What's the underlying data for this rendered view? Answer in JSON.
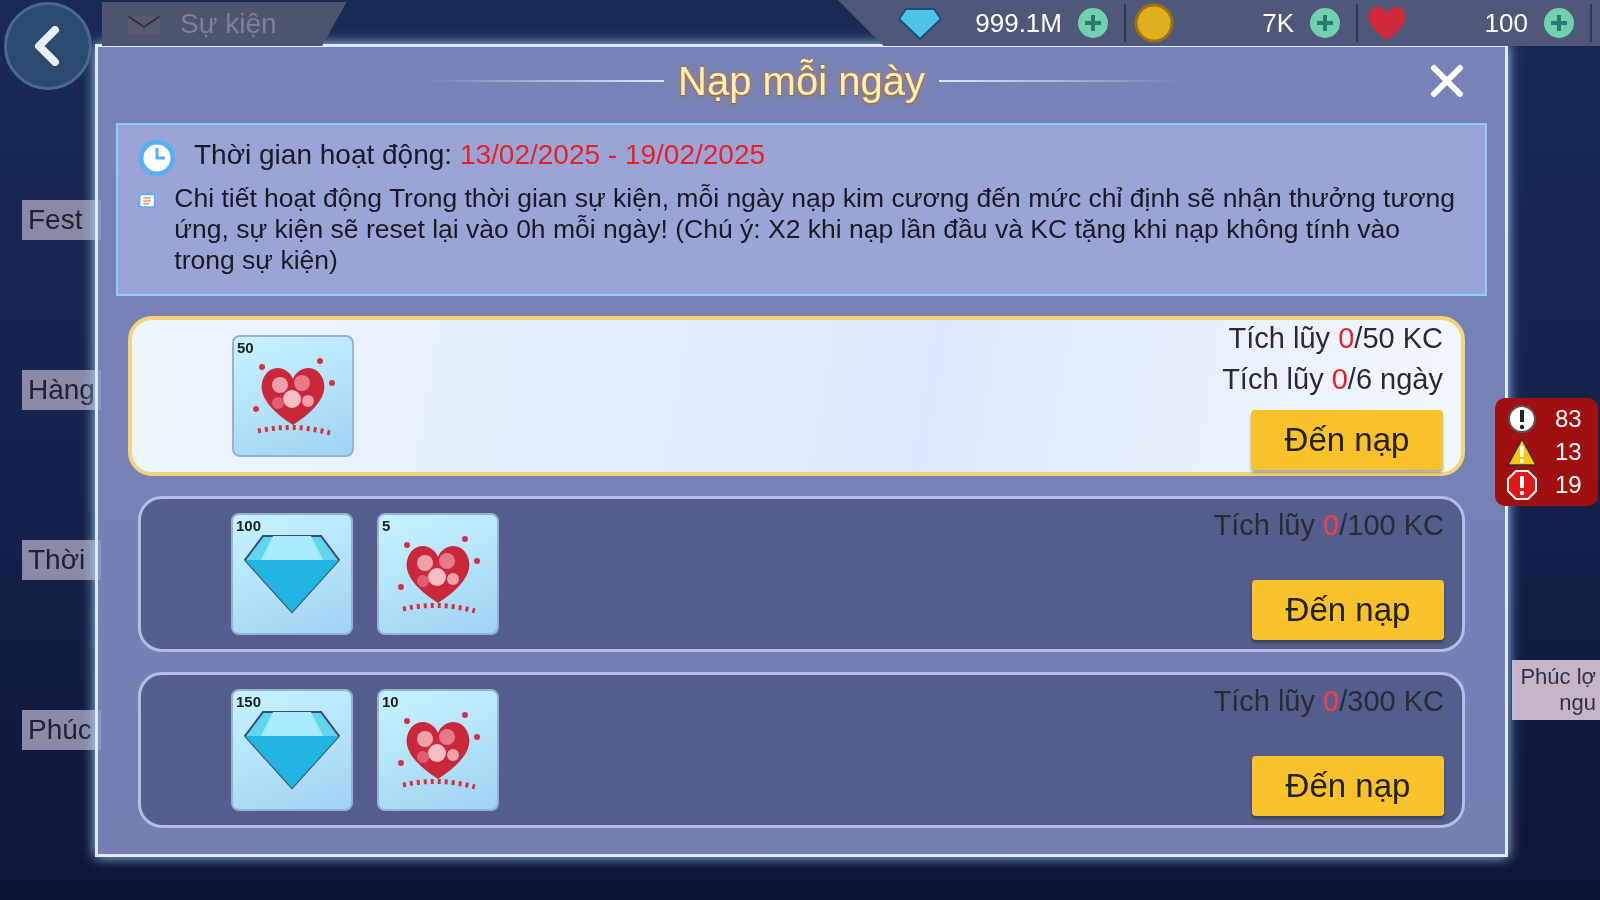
{
  "top_bar": {
    "section_title": "Sự kiện",
    "currencies": [
      {
        "kind": "diamond",
        "amount": "999.1M"
      },
      {
        "kind": "coin",
        "amount": "7K"
      },
      {
        "kind": "heart",
        "amount": "100"
      }
    ]
  },
  "side_tabs": [
    {
      "label": "Fest"
    },
    {
      "label": "Hàng"
    },
    {
      "label": "Thời"
    },
    {
      "label": "Phúc"
    }
  ],
  "right_peek": "Phúc lợ ngu",
  "dialog": {
    "title": "Nạp mỗi ngày",
    "info": {
      "time_label": "Thời gian hoạt động:",
      "time_range": "13/02/2025 - 19/02/2025",
      "details": "Chi tiết hoạt động Trong thời gian sự kiện, mỗi ngày nạp kim cương đến mức chỉ định sẽ nhận thưởng tương ứng, sự kiện sẽ reset lại vào 0h mỗi ngày! (Chú ý: X2 khi nạp lần đầu và KC tặng khi nạp không tính vào trong sự kiện)"
    },
    "tiers": [
      {
        "highlighted": true,
        "rewards": [
          {
            "kind": "roses",
            "count": "50"
          }
        ],
        "progress": [
          {
            "prefix": "Tích lũy ",
            "current": "0",
            "rest": "/50 KC"
          },
          {
            "prefix": "Tích lũy ",
            "current": "0",
            "rest": "/6 ngày"
          }
        ],
        "button": "Đến nạp"
      },
      {
        "highlighted": false,
        "rewards": [
          {
            "kind": "diamond",
            "count": "100"
          },
          {
            "kind": "roses",
            "count": "5"
          }
        ],
        "progress": [
          {
            "prefix": "Tích lũy ",
            "current": "0",
            "rest": "/100 KC"
          }
        ],
        "button": "Đến nạp"
      },
      {
        "highlighted": false,
        "rewards": [
          {
            "kind": "diamond",
            "count": "150"
          },
          {
            "kind": "roses",
            "count": "10"
          }
        ],
        "progress": [
          {
            "prefix": "Tích lũy ",
            "current": "0",
            "rest": "/300 KC"
          }
        ],
        "button": "Đến nạp"
      }
    ]
  },
  "debug_badge": [
    {
      "kind": "info",
      "count": "83"
    },
    {
      "kind": "warning",
      "count": "13"
    },
    {
      "kind": "error",
      "count": "19"
    }
  ]
}
